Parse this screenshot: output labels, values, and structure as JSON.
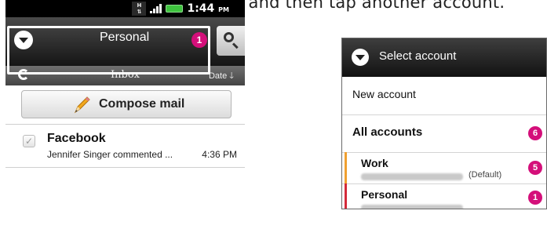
{
  "caption": "different email account, and then tap another account.",
  "phone": {
    "status": {
      "network_label": "H",
      "time": "1:44",
      "time_suffix": "PM",
      "battery_color": "#3ec23e"
    },
    "account_bar": {
      "title": "Personal",
      "unread_count": "1",
      "badge_color": "#d40f7a"
    },
    "inbox_bar": {
      "title": "Inbox",
      "sort_label": "Date",
      "sort_direction_icon": "arrow-down-icon"
    },
    "compose_label": "Compose mail",
    "messages": [
      {
        "sender": "Facebook",
        "snippet": "Jennifer Singer commented ...",
        "time": "4:36 PM"
      }
    ]
  },
  "popup": {
    "title": "Select account",
    "new_account_label": "New account",
    "all_accounts": {
      "label": "All accounts",
      "count": "6"
    },
    "accounts": [
      {
        "name": "Work",
        "default_label": "(Default)",
        "count": "5",
        "stripe_color": "#f0a030"
      },
      {
        "name": "Personal",
        "default_label": "",
        "count": "1",
        "stripe_color": "#d42a3a"
      }
    ]
  }
}
